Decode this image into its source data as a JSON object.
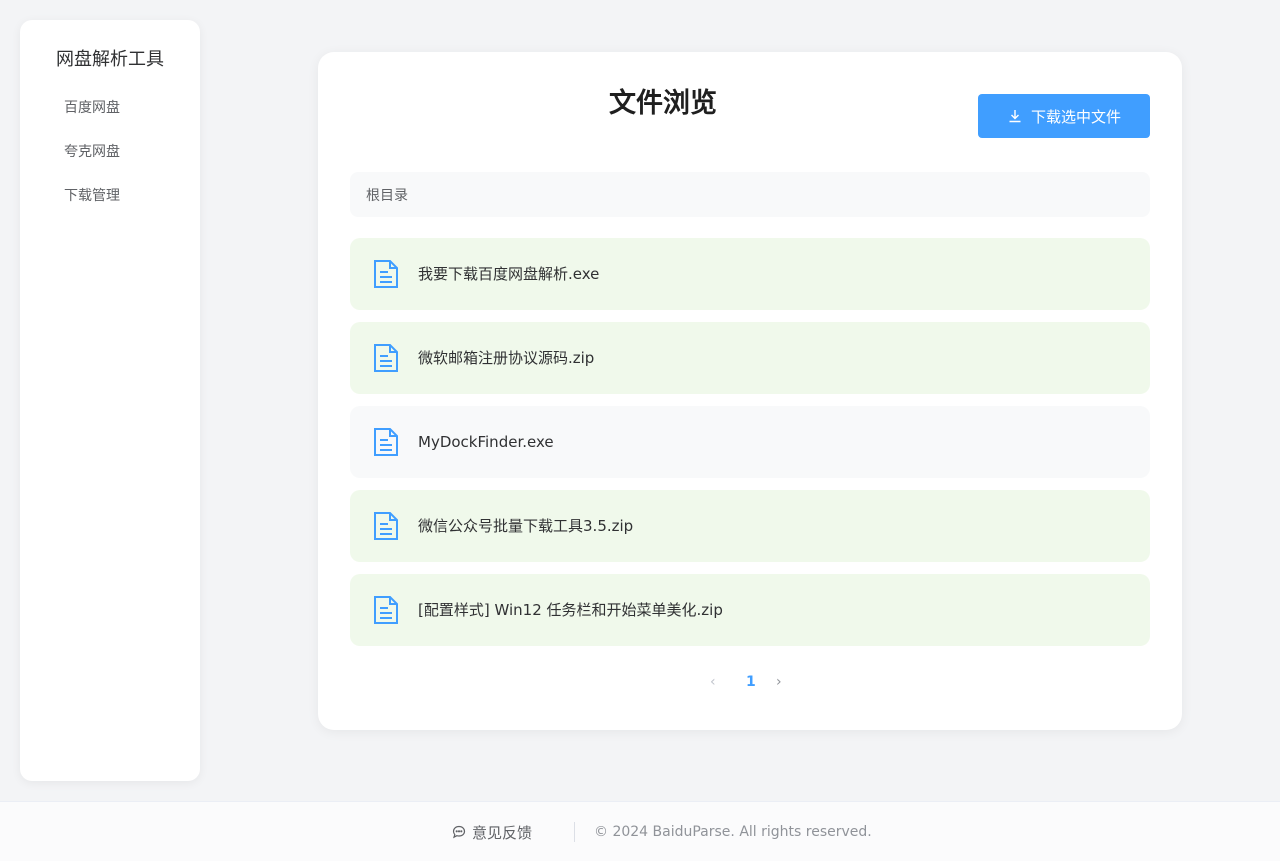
{
  "sidebar": {
    "title": "网盘解析工具",
    "items": [
      {
        "label": "百度网盘"
      },
      {
        "label": "夸克网盘"
      },
      {
        "label": "下载管理"
      }
    ]
  },
  "main": {
    "title": "文件浏览",
    "download_button": "下载选中文件",
    "breadcrumb": "根目录",
    "files": [
      {
        "name": "我要下载百度网盘解析.exe",
        "selected": true,
        "icon": "document-icon"
      },
      {
        "name": "微软邮箱注册协议源码.zip",
        "selected": true,
        "icon": "document-icon"
      },
      {
        "name": "MyDockFinder.exe",
        "selected": false,
        "icon": "document-icon"
      },
      {
        "name": "微信公众号批量下载工具3.5.zip",
        "selected": true,
        "icon": "document-icon"
      },
      {
        "name": "[配置样式] Win12 任务栏和开始菜单美化.zip",
        "selected": true,
        "icon": "document-icon"
      }
    ],
    "pagination": {
      "prev": "‹",
      "current": "1",
      "next": "›"
    }
  },
  "footer": {
    "feedback": "意见反馈",
    "copyright": "© 2024 BaiduParse. All rights reserved."
  },
  "colors": {
    "accent": "#409eff",
    "selected_bg": "#f0f9eb",
    "page_bg": "#f3f4f6"
  }
}
